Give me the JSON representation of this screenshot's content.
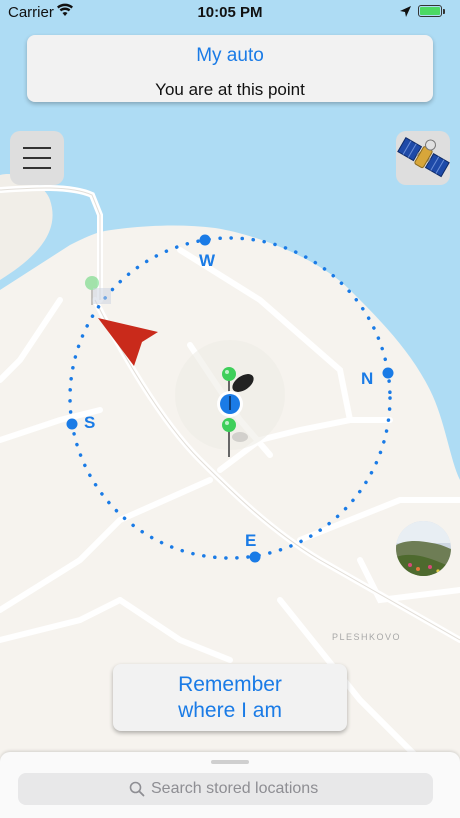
{
  "status_bar": {
    "carrier": "Carrier",
    "time": "10:05 PM"
  },
  "info_card": {
    "title": "My auto",
    "subtitle": "You are at this point"
  },
  "compass": {
    "w": "W",
    "n": "N",
    "s": "S",
    "e": "E"
  },
  "map": {
    "town_label": "PLESHKOVO"
  },
  "remember_button": {
    "line1": "Remember",
    "line2": "where I am"
  },
  "search": {
    "placeholder": "Search stored locations"
  },
  "colors": {
    "accent": "#1a7be6",
    "water": "#aedcf4",
    "land": "#f6f3ee",
    "arrow": "#c92a1b",
    "pin_green": "#3ecf5a"
  },
  "icons": [
    "wifi-icon",
    "location-arrow-icon",
    "battery-icon",
    "menu-icon",
    "satellite-icon",
    "search-icon",
    "direction-arrow-icon"
  ]
}
